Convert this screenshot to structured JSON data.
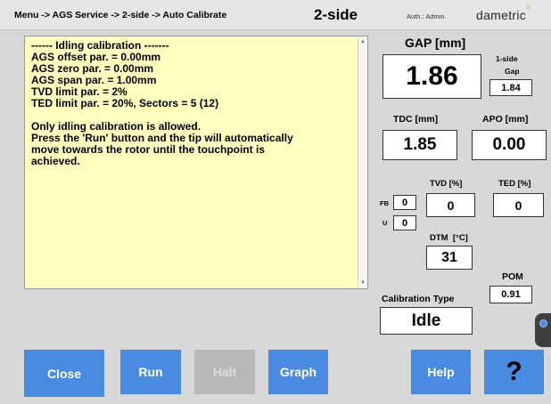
{
  "header": {
    "breadcrumb": "Menu -> AGS Service -> 2-side -> Auto Calibrate",
    "mode": "2-side",
    "auth": "Auth.: Admin.",
    "brand": "dametric"
  },
  "log": {
    "lines": [
      "------ Idling calibration -------",
      "AGS offset par. = 0.00mm",
      "AGS zero par. = 0.00mm",
      "AGS span par. = 1.00mm",
      "TVD limit par. = 2%",
      "TED limit par. = 20%, Sectors = 5 (12)",
      "",
      "Only idling calibration is allowed.",
      "Press the 'Run' button and the tip will automatically",
      "move towards the rotor until the touchpoint is",
      "achieved."
    ]
  },
  "readouts": {
    "gap_label": "GAP [mm]",
    "gap_value": "1.86",
    "one_side_label": "1-side",
    "gap_sub_label": "Gap",
    "one_side_gap_value": "1.84",
    "tdc_label": "TDC [mm]",
    "tdc_value": "1.85",
    "apo_label": "APO [mm]",
    "apo_value": "0.00",
    "tvd_label": "TVD [%]",
    "tvd_value": "0",
    "ted_label": "TED [%]",
    "ted_value": "0",
    "fb_label": "FB",
    "fb_value": "0",
    "u_label": "U",
    "u_value": "0",
    "dtm_label": "DTM  [°C]",
    "dtm_value": "31",
    "pom_label": "POM",
    "pom_value": "0.91",
    "cal_type_label": "Calibration Type",
    "cal_type_value": "Idle"
  },
  "buttons": {
    "close": "Close",
    "run": "Run",
    "halt": "Halt",
    "graph": "Graph",
    "help": "Help",
    "question": "?"
  },
  "colors": {
    "button_blue": "#4a8be2",
    "log_background": "#ffffbf",
    "disabled_grey": "#b8b8b8"
  },
  "icons": {
    "side_tab": "side-panel-tab-icon"
  }
}
